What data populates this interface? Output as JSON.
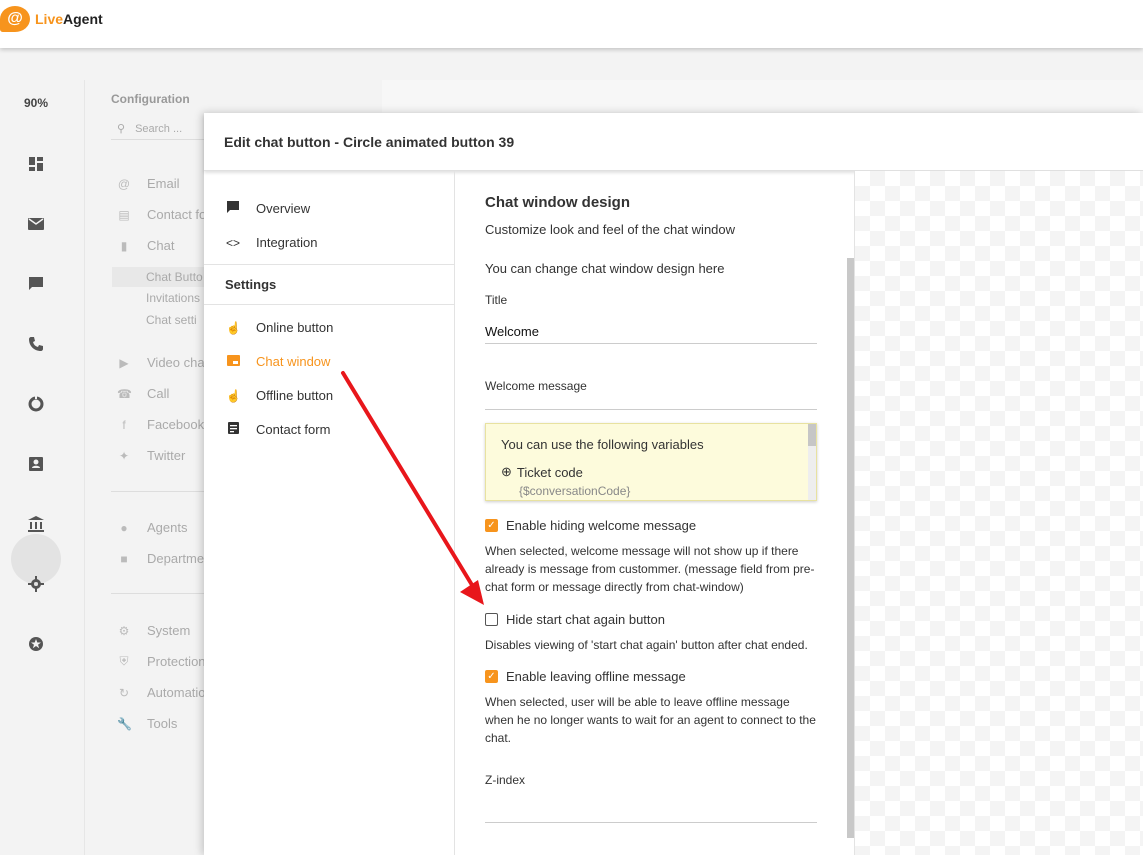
{
  "app": {
    "logo_mark": "@",
    "logo_text_a": "Live",
    "logo_text_b": "Agent"
  },
  "rail": {
    "zoom": "90%"
  },
  "config": {
    "title": "Configuration",
    "search_placeholder": "Search ...",
    "items": [
      {
        "label": "Email",
        "icon": "at-icon"
      },
      {
        "label": "Contact fo",
        "icon": "form-icon"
      },
      {
        "label": "Chat",
        "icon": "chat-icon"
      }
    ],
    "chat_sub": [
      "Chat Butto",
      "Invitations",
      "Chat setti"
    ],
    "items2": [
      {
        "label": "Video cha",
        "icon": "video-icon"
      },
      {
        "label": "Call",
        "icon": "phone-icon"
      },
      {
        "label": "Facebook",
        "icon": "facebook-icon"
      },
      {
        "label": "Twitter",
        "icon": "twitter-icon"
      }
    ],
    "items3": [
      {
        "label": "Agents",
        "icon": "agents-icon"
      },
      {
        "label": "Departme",
        "icon": "folder-icon"
      }
    ],
    "items4": [
      {
        "label": "System",
        "icon": "gear-icon"
      },
      {
        "label": "Protection",
        "icon": "shield-icon"
      },
      {
        "label": "Automatio",
        "icon": "refresh-icon"
      },
      {
        "label": "Tools",
        "icon": "wrench-icon"
      }
    ]
  },
  "modal": {
    "title": "Edit chat button - Circle animated button 39",
    "nav": {
      "overview": "Overview",
      "integration": "Integration",
      "settings_heading": "Settings",
      "online_button": "Online button",
      "chat_window": "Chat window",
      "offline_button": "Offline button",
      "contact_form": "Contact form"
    },
    "content": {
      "heading": "Chat window design",
      "subheading": "Customize look and feel of the chat window",
      "intro": "You can change chat window design here",
      "title_label": "Title",
      "title_value": "Welcome",
      "welcome_label": "Welcome message",
      "welcome_value": "",
      "variables_title": "You can use the following variables",
      "variable_name": "Ticket code",
      "variable_code": "{$conversationCode}",
      "enable_hiding_label": "Enable hiding welcome message",
      "enable_hiding_checked": true,
      "enable_hiding_desc": "When selected, welcome message will not show up if there already is message from custommer. (message field from pre-chat form or message directly from chat-window)",
      "hide_start_label": "Hide start chat again button",
      "hide_start_checked": false,
      "hide_start_desc": "Disables viewing of 'start chat again' button after chat ended.",
      "offline_label": "Enable leaving offline message",
      "offline_checked": true,
      "offline_desc": "When selected, user will be able to leave offline message when he no longer wants to wait for an agent to connect to the chat.",
      "zindex_label": "Z-index",
      "zindex_value": ""
    }
  },
  "colors": {
    "accent": "#f7941d",
    "arrow": "#e8161b"
  }
}
